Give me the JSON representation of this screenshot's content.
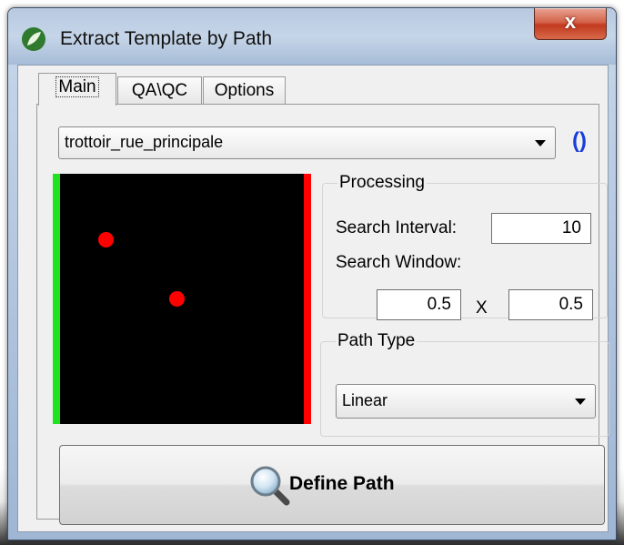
{
  "window": {
    "title": "Extract Template by Path",
    "close_label": "x"
  },
  "tabs": [
    {
      "label": "Main",
      "active": true
    },
    {
      "label": "QA\\QC",
      "active": false
    },
    {
      "label": "Options",
      "active": false
    }
  ],
  "template_select": {
    "value": "trottoir_rue_principale"
  },
  "refresh_glyph": "()",
  "processing": {
    "legend": "Processing",
    "search_interval_label": "Search Interval:",
    "search_interval_value": "10",
    "search_window_label": "Search Window:",
    "window_x_value": "0.5",
    "times_label": "X",
    "window_y_value": "0.5"
  },
  "path_type": {
    "legend": "Path Type",
    "value": "Linear"
  },
  "define_button": {
    "label": "Define Path"
  },
  "colors": {
    "start_bar": "#1ee41e",
    "end_bar": "#ff0000",
    "points": "#ff0000",
    "refresh_icon": "#1a3ed8"
  }
}
